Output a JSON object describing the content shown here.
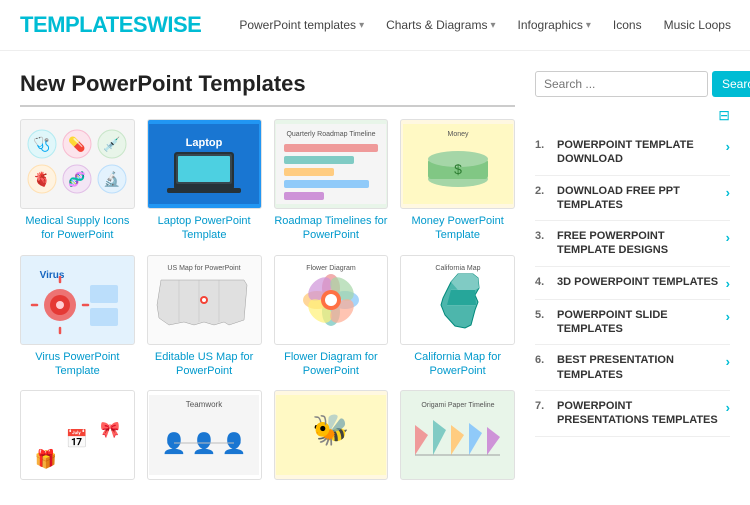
{
  "header": {
    "logo_text": "TEMPLATES",
    "logo_accent": "WISE",
    "nav": [
      {
        "label": "PowerPoint templates",
        "has_arrow": true
      },
      {
        "label": "Charts & Diagrams",
        "has_arrow": true
      },
      {
        "label": "Infographics",
        "has_arrow": true
      },
      {
        "label": "Icons",
        "has_arrow": false
      },
      {
        "label": "Music Loops",
        "has_arrow": false
      }
    ]
  },
  "main": {
    "page_title": "New PowerPoint Templates",
    "templates": [
      {
        "id": "medical",
        "label": "Medical Supply Icons for PowerPoint",
        "thumb_class": "thumb-medical"
      },
      {
        "id": "laptop",
        "label": "Laptop PowerPoint Template",
        "thumb_class": "thumb-laptop"
      },
      {
        "id": "roadmap",
        "label": "Roadmap Timelines for PowerPoint",
        "thumb_class": "thumb-roadmap"
      },
      {
        "id": "money",
        "label": "Money PowerPoint Template",
        "thumb_class": "thumb-money"
      },
      {
        "id": "virus",
        "label": "Virus PowerPoint Template",
        "thumb_class": "thumb-virus"
      },
      {
        "id": "usmap",
        "label": "Editable US Map for PowerPoint",
        "thumb_class": "thumb-usmap"
      },
      {
        "id": "flower",
        "label": "Flower Diagram for PowerPoint",
        "thumb_class": "thumb-flower"
      },
      {
        "id": "california",
        "label": "California Map for PowerPoint",
        "thumb_class": "thumb-california"
      },
      {
        "id": "gift",
        "label": "",
        "thumb_class": "thumb-gift"
      },
      {
        "id": "teamwork",
        "label": "",
        "thumb_class": "thumb-teamwork"
      },
      {
        "id": "bee",
        "label": "",
        "thumb_class": "thumb-bee"
      },
      {
        "id": "origami",
        "label": "",
        "thumb_class": "thumb-origami"
      }
    ]
  },
  "sidebar": {
    "search_placeholder": "Search ...",
    "search_button": "Search",
    "items": [
      {
        "num": "1.",
        "label": "POWERPOINT TEMPLATE DOWNLOAD"
      },
      {
        "num": "2.",
        "label": "DOWNLOAD FREE PPT TEMPLATES"
      },
      {
        "num": "3.",
        "label": "FREE POWERPOINT TEMPLATE DESIGNS"
      },
      {
        "num": "4.",
        "label": "3D POWERPOINT TEMPLATES"
      },
      {
        "num": "5.",
        "label": "POWERPOINT SLIDE TEMPLATES"
      },
      {
        "num": "6.",
        "label": "BEST PRESENTATION TEMPLATES"
      },
      {
        "num": "7.",
        "label": "POWERPOINT PRESENTATIONS TEMPLATES"
      }
    ]
  }
}
